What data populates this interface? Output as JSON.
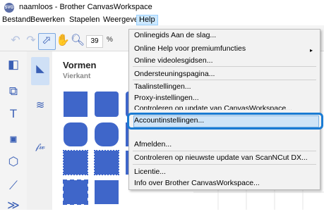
{
  "window": {
    "title": "naamloos - Brother CanvasWorkspace",
    "app_icon_label": "SVG"
  },
  "menubar": [
    "Bestand",
    "Bewerken",
    "Stapelen",
    "Weergeven",
    "Help"
  ],
  "toolbar": {
    "zoom_value": "39",
    "zoom_unit": "%"
  },
  "panel": {
    "title": "Vormen",
    "subtitle": "Vierkant"
  },
  "help_menu": {
    "items": [
      "Onlinegids Aan de slag...",
      "Online Help voor premiumfuncties",
      "Online videolesgidsen...",
      "Ondersteuningspagina...",
      "Taalinstellingen...",
      "Proxy-instellingen...",
      "Controleren op update van CanvasWorkspace...",
      "Accountinstellingen...",
      "Afmelden...",
      "Controleren op nieuwste update van ScanNCut DX...",
      "Licentie...",
      "Info over Brother CanvasWorkspace..."
    ],
    "submenu_arrow": "▸",
    "highlighted": "Accountinstellingen..."
  },
  "colors": {
    "accent": "#3f66c9",
    "highlight_border": "#1a7bd3",
    "menu_bg": "#f2f2f2"
  },
  "icons": [
    "undo-icon",
    "redo-icon",
    "select-icon",
    "pan-icon",
    "zoom-icon",
    "panel-icon",
    "shapes-icon",
    "text-icon",
    "svg-import-icon",
    "trace-icon",
    "line-icon",
    "category-shapes-icon",
    "category-lines-icon",
    "category-text-icon"
  ]
}
